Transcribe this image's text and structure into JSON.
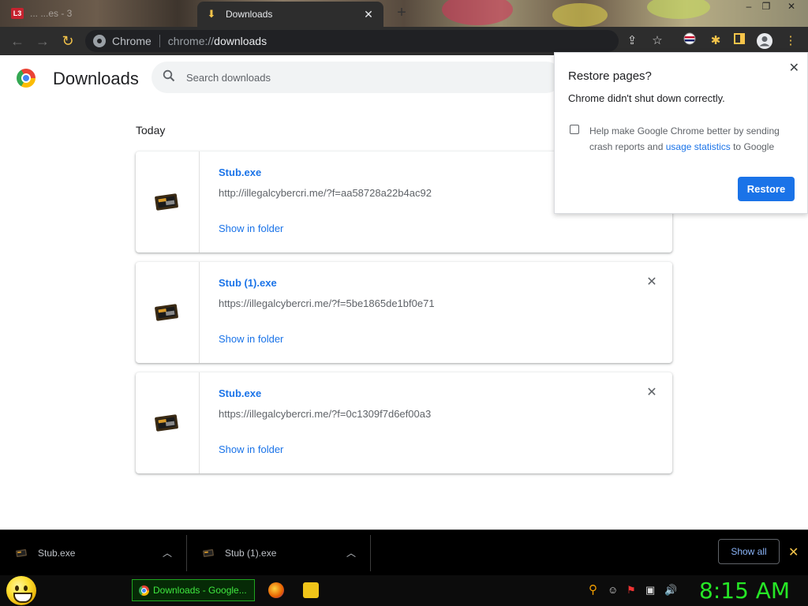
{
  "window": {
    "inactive_tab_label": "... ...es - 3",
    "active_tab_label": "Downloads",
    "tab_close": "✕",
    "new_tab": "+",
    "controls": [
      "–",
      "❐",
      "✕"
    ]
  },
  "toolbar": {
    "back": "←",
    "forward": "→",
    "reload": "↻",
    "site_chip": "Chrome",
    "url_prefix": "chrome://",
    "url_host": "downloads",
    "icons": [
      "share-icon",
      "star-icon",
      "flag-icon",
      "extensions-icon",
      "sidepanel-icon",
      "profile-icon",
      "menu-icon"
    ]
  },
  "page": {
    "title": "Downloads",
    "search_placeholder": "Search downloads",
    "section": "Today"
  },
  "downloads": [
    {
      "name": "Stub.exe",
      "url": "http://illegalcybercri.me/?f=aa58728a22b4ac92",
      "action": "Show in folder"
    },
    {
      "name": "Stub (1).exe",
      "url": "https://illegalcybercri.me/?f=5be1865de1bf0e71",
      "action": "Show in folder"
    },
    {
      "name": "Stub.exe",
      "url": "https://illegalcybercri.me/?f=0c1309f7d6ef00a3",
      "action": "Show in folder"
    }
  ],
  "restore_popup": {
    "title": "Restore pages?",
    "message": "Chrome didn't shut down correctly.",
    "help_text_before": "Help make Google Chrome better by sending crash reports and ",
    "help_link": "usage statistics",
    "help_text_after": " to Google",
    "button": "Restore"
  },
  "shelf": {
    "items": [
      {
        "name": "Stub.exe"
      },
      {
        "name": "Stub (1).exe"
      }
    ],
    "show_all": "Show all",
    "close": "✕"
  },
  "taskbar": {
    "task_label": "Downloads - Google...",
    "clock": "8:15 AM"
  },
  "colors": {
    "link": "#1a73e8",
    "clock": "#26e626",
    "task_text": "#3fe83f",
    "accent": "#f5c44a"
  }
}
